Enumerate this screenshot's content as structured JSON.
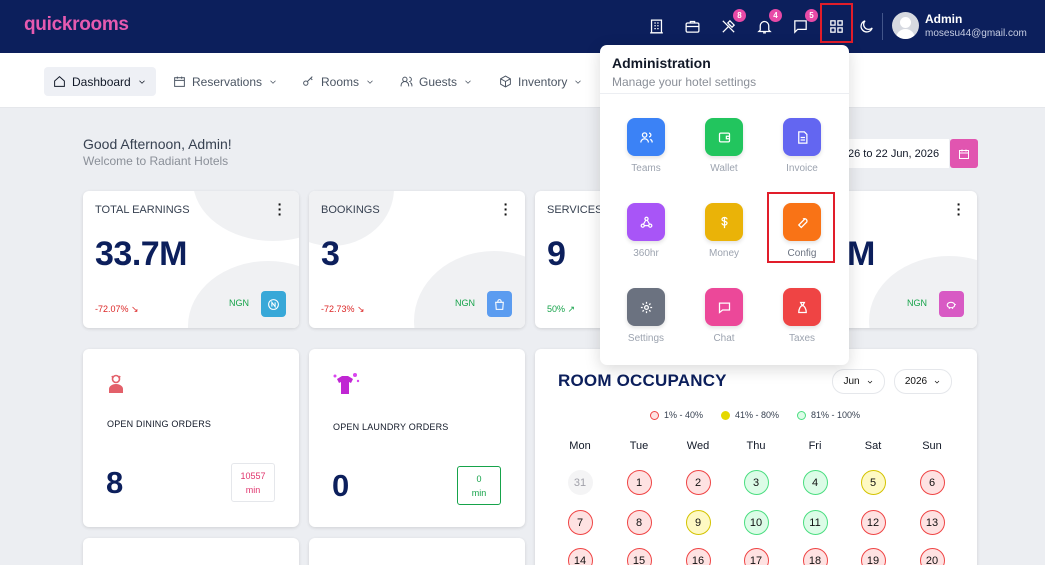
{
  "app": {
    "logo": "quickrooms"
  },
  "topbar": {
    "icons": [
      {
        "name": "building-icon",
        "badge": ""
      },
      {
        "name": "suitcase-icon",
        "badge": ""
      },
      {
        "name": "tools-icon",
        "badge": "8"
      },
      {
        "name": "bell-icon",
        "badge": "4"
      },
      {
        "name": "chat-icon",
        "badge": "5"
      },
      {
        "name": "grid-icon",
        "badge": ""
      },
      {
        "name": "moon-icon",
        "badge": ""
      }
    ],
    "user": {
      "name": "Admin",
      "email": "mosesu44@gmail.com"
    }
  },
  "nav": {
    "items": [
      {
        "label": "Dashboard"
      },
      {
        "label": "Reservations"
      },
      {
        "label": "Rooms"
      },
      {
        "label": "Guests"
      },
      {
        "label": "Inventory"
      }
    ]
  },
  "greeting": {
    "title": "Good Afternoon, Admin!",
    "subtitle": "Welcome to Radiant Hotels"
  },
  "date_range": "26 to 22 Jun, 2026",
  "stats": [
    {
      "title": "TOTAL EARNINGS",
      "value": "33.7M",
      "change": "-72.07%",
      "currency": "NGN",
      "color": "#38a8d8"
    },
    {
      "title": "BOOKINGS",
      "value": "3",
      "change": "-72.73%",
      "currency": "NGN",
      "color": "#5b9cf0"
    },
    {
      "title": "SERVICES",
      "value": "9",
      "change": "50%",
      "currency": "",
      "color": ""
    },
    {
      "title": "",
      "value": "M",
      "change": "",
      "currency": "NGN",
      "color": "#d85ac4"
    }
  ],
  "orders": {
    "dining": {
      "title": "OPEN DINING ORDERS",
      "value": "8",
      "mins_value": "10557",
      "mins_unit": "min"
    },
    "laundry": {
      "title": "OPEN LAUNDRY ORDERS",
      "value": "0",
      "mins_value": "0",
      "mins_unit": "min"
    }
  },
  "occupancy": {
    "title": "ROOM OCCUPANCY",
    "month": "Jun",
    "year": "2026",
    "legend": [
      {
        "label": "1% - 40%",
        "color": "#ef4444"
      },
      {
        "label": "41% - 80%",
        "color": "#e5d800"
      },
      {
        "label": "81% - 100%",
        "color": "#4ade80"
      }
    ],
    "weekdays": [
      "Mon",
      "Tue",
      "Wed",
      "Thu",
      "Fri",
      "Sat",
      "Sun"
    ],
    "weeks": [
      [
        {
          "d": "31",
          "c": "n"
        },
        {
          "d": "1",
          "c": "r"
        },
        {
          "d": "2",
          "c": "r"
        },
        {
          "d": "3",
          "c": "g"
        },
        {
          "d": "4",
          "c": "g"
        },
        {
          "d": "5",
          "c": "y"
        },
        {
          "d": "6",
          "c": "r"
        }
      ],
      [
        {
          "d": "7",
          "c": "r"
        },
        {
          "d": "8",
          "c": "r"
        },
        {
          "d": "9",
          "c": "y"
        },
        {
          "d": "10",
          "c": "g"
        },
        {
          "d": "11",
          "c": "g"
        },
        {
          "d": "12",
          "c": "r"
        },
        {
          "d": "13",
          "c": "r"
        }
      ],
      [
        {
          "d": "14",
          "c": "r"
        },
        {
          "d": "15",
          "c": "r"
        },
        {
          "d": "16",
          "c": "r"
        },
        {
          "d": "17",
          "c": "r"
        },
        {
          "d": "18",
          "c": "r"
        },
        {
          "d": "19",
          "c": "r"
        },
        {
          "d": "20",
          "c": "r"
        }
      ]
    ]
  },
  "admin": {
    "title": "Administration",
    "subtitle": "Manage your hotel settings",
    "tiles": [
      {
        "label": "Teams",
        "color": "#3b82f6",
        "icon": "users-icon"
      },
      {
        "label": "Wallet",
        "color": "#22c55e",
        "icon": "wallet-icon"
      },
      {
        "label": "Invoice",
        "color": "#6366f1",
        "icon": "document-icon"
      },
      {
        "label": "360hr",
        "color": "#a855f7",
        "icon": "network-icon"
      },
      {
        "label": "Money",
        "color": "#eab308",
        "icon": "dollar-icon"
      },
      {
        "label": "Config",
        "color": "#f97316",
        "icon": "wrench-icon"
      },
      {
        "label": "Settings",
        "color": "#6b7280",
        "icon": "gear-icon"
      },
      {
        "label": "Chat",
        "color": "#ec4899",
        "icon": "message-icon"
      },
      {
        "label": "Taxes",
        "color": "#ef4444",
        "icon": "money-bag-icon"
      }
    ]
  }
}
